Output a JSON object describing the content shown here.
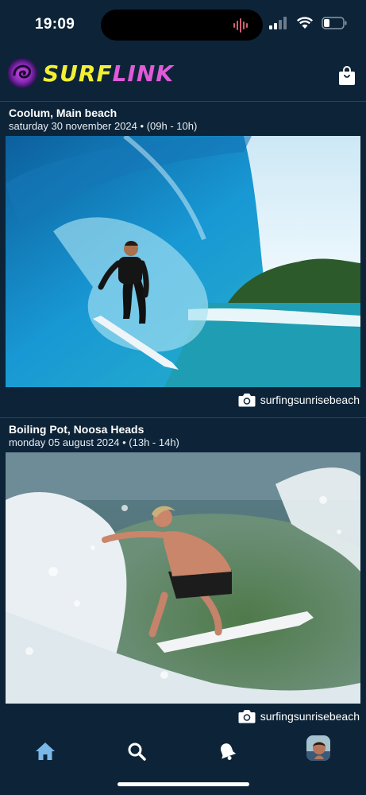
{
  "status": {
    "time": "19:09"
  },
  "header": {
    "logo_text_1": "SURF",
    "logo_text_2": "LINK"
  },
  "posts": [
    {
      "title": "Coolum, Main beach",
      "date": "saturday 30 november 2024",
      "time": "(09h - 10h)",
      "photographer": "surfingsunrisebeach"
    },
    {
      "title": "Boiling Pot, Noosa Heads",
      "date": "monday 05 august 2024",
      "time": "(13h - 14h)",
      "photographer": "surfingsunrisebeach"
    }
  ],
  "tabs": [
    "home-icon",
    "search-icon",
    "bell-icon",
    "profile-avatar"
  ],
  "colors": {
    "background": "#0d2438",
    "logo_yellow": "#f3f033",
    "logo_pink": "#e05ad8",
    "active_tab": "#7ab8e8"
  }
}
